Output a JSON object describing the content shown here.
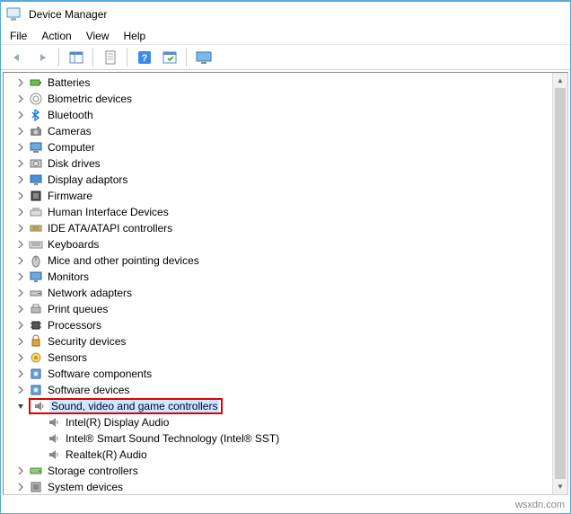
{
  "window": {
    "title": "Device Manager"
  },
  "menu": {
    "file": "File",
    "action": "Action",
    "view": "View",
    "help": "Help"
  },
  "toolbar": {
    "back": "back-icon",
    "forward": "forward-icon",
    "show": "show-icon",
    "props": "properties-icon",
    "help": "help-icon",
    "refresh": "refresh-icon",
    "monitor": "monitor-icon"
  },
  "tree": [
    {
      "label": "Batteries",
      "icon": "battery",
      "expand": "closed",
      "depth": 1
    },
    {
      "label": "Biometric devices",
      "icon": "fingerprint",
      "expand": "closed",
      "depth": 1
    },
    {
      "label": "Bluetooth",
      "icon": "bluetooth",
      "expand": "closed",
      "depth": 1
    },
    {
      "label": "Cameras",
      "icon": "camera",
      "expand": "closed",
      "depth": 1
    },
    {
      "label": "Computer",
      "icon": "computer",
      "expand": "closed",
      "depth": 1
    },
    {
      "label": "Disk drives",
      "icon": "disk",
      "expand": "closed",
      "depth": 1
    },
    {
      "label": "Display adaptors",
      "icon": "display",
      "expand": "closed",
      "depth": 1
    },
    {
      "label": "Firmware",
      "icon": "firmware",
      "expand": "closed",
      "depth": 1
    },
    {
      "label": "Human Interface Devices",
      "icon": "hid",
      "expand": "closed",
      "depth": 1
    },
    {
      "label": "IDE ATA/ATAPI controllers",
      "icon": "ide",
      "expand": "closed",
      "depth": 1
    },
    {
      "label": "Keyboards",
      "icon": "keyboard",
      "expand": "closed",
      "depth": 1
    },
    {
      "label": "Mice and other pointing devices",
      "icon": "mouse",
      "expand": "closed",
      "depth": 1
    },
    {
      "label": "Monitors",
      "icon": "monitor",
      "expand": "closed",
      "depth": 1
    },
    {
      "label": "Network adapters",
      "icon": "network",
      "expand": "closed",
      "depth": 1
    },
    {
      "label": "Print queues",
      "icon": "printer",
      "expand": "closed",
      "depth": 1
    },
    {
      "label": "Processors",
      "icon": "cpu",
      "expand": "closed",
      "depth": 1
    },
    {
      "label": "Security devices",
      "icon": "security",
      "expand": "closed",
      "depth": 1
    },
    {
      "label": "Sensors",
      "icon": "sensor",
      "expand": "closed",
      "depth": 1
    },
    {
      "label": "Software components",
      "icon": "software",
      "expand": "closed",
      "depth": 1
    },
    {
      "label": "Software devices",
      "icon": "software",
      "expand": "closed",
      "depth": 1
    },
    {
      "label": "Sound, video and game controllers",
      "icon": "sound",
      "expand": "open",
      "depth": 1,
      "selected": true,
      "highlighted": true
    },
    {
      "label": "Intel(R) Display Audio",
      "icon": "sound",
      "expand": "none",
      "depth": 2
    },
    {
      "label": "Intel® Smart Sound Technology (Intel® SST)",
      "icon": "sound",
      "expand": "none",
      "depth": 2
    },
    {
      "label": "Realtek(R) Audio",
      "icon": "sound",
      "expand": "none",
      "depth": 2
    },
    {
      "label": "Storage controllers",
      "icon": "storage",
      "expand": "closed",
      "depth": 1
    },
    {
      "label": "System devices",
      "icon": "system",
      "expand": "closed",
      "depth": 1,
      "truncated": true
    }
  ],
  "footer": {
    "watermark": "wsxdn.com"
  }
}
